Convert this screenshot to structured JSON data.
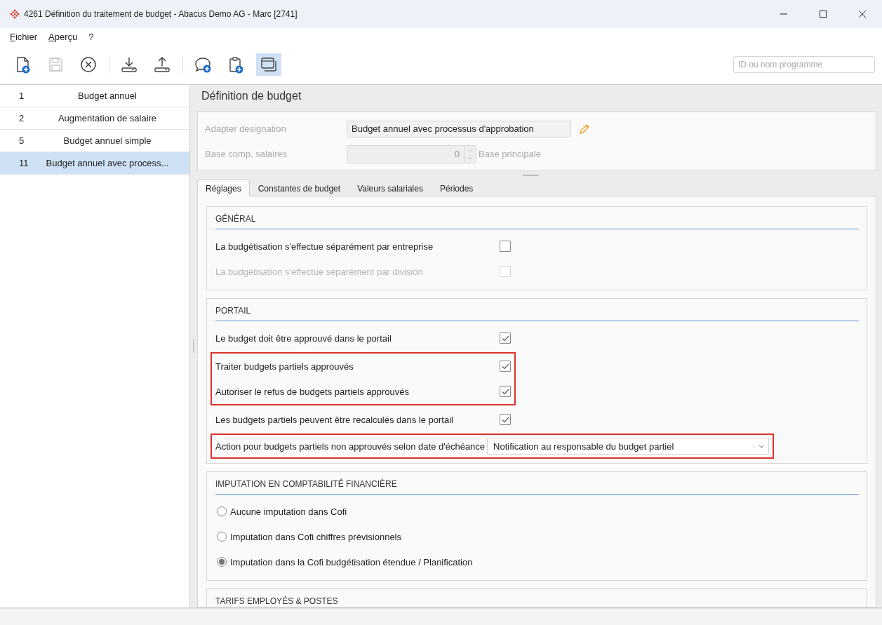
{
  "window": {
    "title": "4261 Définition du traitement de budget - Abacus Demo AG - Marc [2741]"
  },
  "menu": [
    {
      "label": "Fichier"
    },
    {
      "label": "Aperçu"
    },
    {
      "label": "?"
    }
  ],
  "toolbar": [
    {
      "buttons": [
        {
          "kind": "new-document",
          "disabled": false,
          "selected": false
        },
        {
          "kind": "save",
          "disabled": true,
          "selected": false
        },
        {
          "kind": "cancel",
          "disabled": false,
          "selected": false
        }
      ]
    },
    {
      "buttons": [
        {
          "kind": "download",
          "disabled": false,
          "selected": false
        },
        {
          "kind": "upload",
          "disabled": false,
          "selected": false
        }
      ]
    },
    {
      "buttons": [
        {
          "kind": "comment-add",
          "disabled": false,
          "selected": false
        },
        {
          "kind": "clipboard-add",
          "disabled": false,
          "selected": false
        },
        {
          "kind": "window",
          "disabled": false,
          "selected": true
        }
      ]
    }
  ],
  "program_search": {
    "placeholder": "ID ou nom programme"
  },
  "sidebar": {
    "items": [
      {
        "number": "1",
        "name": "Budget annuel",
        "selected": false
      },
      {
        "number": "2",
        "name": "Augmentation de salaire",
        "selected": false
      },
      {
        "number": "5",
        "name": "Budget annuel simple",
        "selected": false
      },
      {
        "number": "11",
        "name": "Budget annuel avec process...",
        "selected": true
      }
    ]
  },
  "panel": {
    "title": "Définition de budget",
    "fields": [
      {
        "kind": "text",
        "label": "Adapter désignation",
        "value": "Budget annuel avec processus d'approbation",
        "disabled": false
      },
      {
        "kind": "spinner",
        "label": "Base comp. salaires",
        "value": "0",
        "suffix": "Base principale",
        "disabled": true
      }
    ]
  },
  "tabs": [
    {
      "label": "Réglages",
      "selected": true
    },
    {
      "label": "Constantes de budget",
      "selected": false
    },
    {
      "label": "Valeurs salariales",
      "selected": false
    },
    {
      "label": "Périodes",
      "selected": false
    }
  ],
  "sections": [
    {
      "heading": "GÉNÉRAL",
      "blocks": [
        {
          "highlighted": false,
          "rows": [
            {
              "kind": "checkbox",
              "label": "La budgétisation s'effectue séparément par entreprise",
              "checked": false,
              "disabled": false
            },
            {
              "kind": "checkbox",
              "label": "La budgétisation s'effectue séparément par division",
              "checked": false,
              "disabled": true
            }
          ]
        }
      ]
    },
    {
      "heading": "PORTAIL",
      "blocks": [
        {
          "highlighted": false,
          "rows": [
            {
              "kind": "checkbox",
              "label": "Le budget doit être approuvé dans le portail",
              "checked": true,
              "disabled": false
            }
          ]
        },
        {
          "highlighted": true,
          "rows": [
            {
              "kind": "checkbox",
              "label": "Traiter budgets partiels approuvés",
              "checked": true,
              "disabled": false
            },
            {
              "kind": "checkbox",
              "label": "Autoriser le refus de budgets partiels approuvés",
              "checked": true,
              "disabled": false
            }
          ]
        },
        {
          "highlighted": false,
          "rows": [
            {
              "kind": "checkbox",
              "label": "Les budgets partiels peuvent être recalculés dans le portail",
              "checked": true,
              "disabled": false
            }
          ]
        },
        {
          "highlighted": true,
          "rows": [
            {
              "kind": "dropdown",
              "label": "Action pour budgets partiels non approuvés selon date d'échéance",
              "value": "Notification au responsable du budget partiel"
            }
          ]
        }
      ]
    },
    {
      "heading": "IMPUTATION EN COMPTABILITÉ FINANCIÈRE",
      "blocks": [
        {
          "highlighted": false,
          "rows": [
            {
              "kind": "radio",
              "label": "Aucune imputation dans Cofi",
              "selected": false
            },
            {
              "kind": "radio",
              "label": "Imputation dans Cofi chiffres prévisionnels",
              "selected": false
            },
            {
              "kind": "radio",
              "label": "Imputation dans la Cofi budgétisation étendue / Planification",
              "selected": true
            }
          ]
        }
      ]
    },
    {
      "heading": "TARIFS EMPLOYÉS & POSTES"
    }
  ]
}
